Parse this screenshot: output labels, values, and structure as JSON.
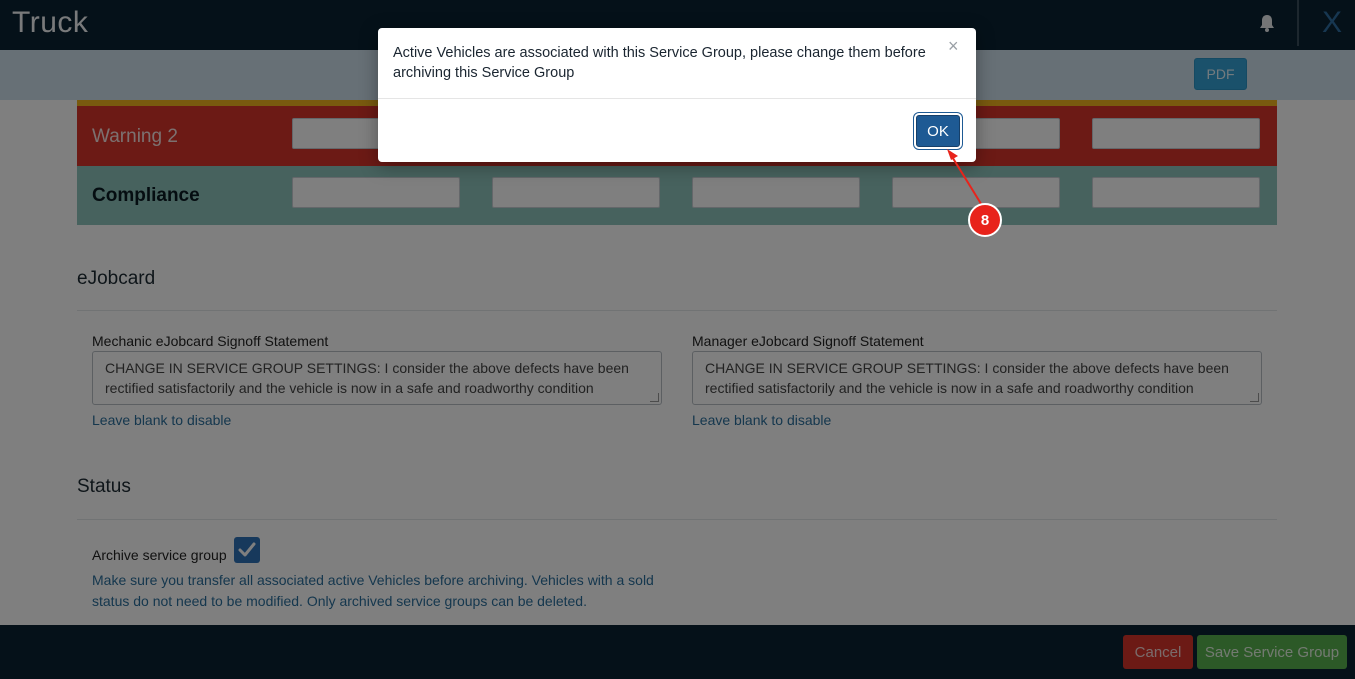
{
  "app": {
    "title": "Truck",
    "close_glyph": "X"
  },
  "toolbar": {
    "pdf_label": "PDF"
  },
  "thresholds": [
    {
      "label": "Warning 2",
      "color": "#d9342b"
    },
    {
      "label": "Compliance",
      "color": "#8fc5bc"
    }
  ],
  "ejobcard": {
    "title": "eJobcard",
    "mechanic": {
      "label": "Mechanic eJobcard Signoff Statement",
      "value": "CHANGE IN SERVICE GROUP SETTINGS: I consider the above defects have been rectified satisfactorily and the vehicle is now in a safe and roadworthy condition",
      "help": "Leave blank to disable"
    },
    "manager": {
      "label": "Manager eJobcard Signoff Statement",
      "value": "CHANGE IN SERVICE GROUP SETTINGS: I consider the above defects have been rectified satisfactorily and the vehicle is now in a safe and roadworthy condition",
      "help": "Leave blank to disable"
    }
  },
  "status": {
    "title": "Status",
    "archive_label": "Archive service group",
    "archive_checked": true,
    "help": "Make sure you transfer all associated active Vehicles before archiving. Vehicles with a sold status do not need to be modified. Only archived service groups can be deleted."
  },
  "footer": {
    "cancel_label": "Cancel",
    "save_label": "Save Service Group"
  },
  "modal": {
    "message": "Active Vehicles are associated with this Service Group, please change them before archiving this Service Group",
    "close_glyph": "×",
    "ok_label": "OK"
  },
  "annotation": {
    "step_number": "8"
  }
}
